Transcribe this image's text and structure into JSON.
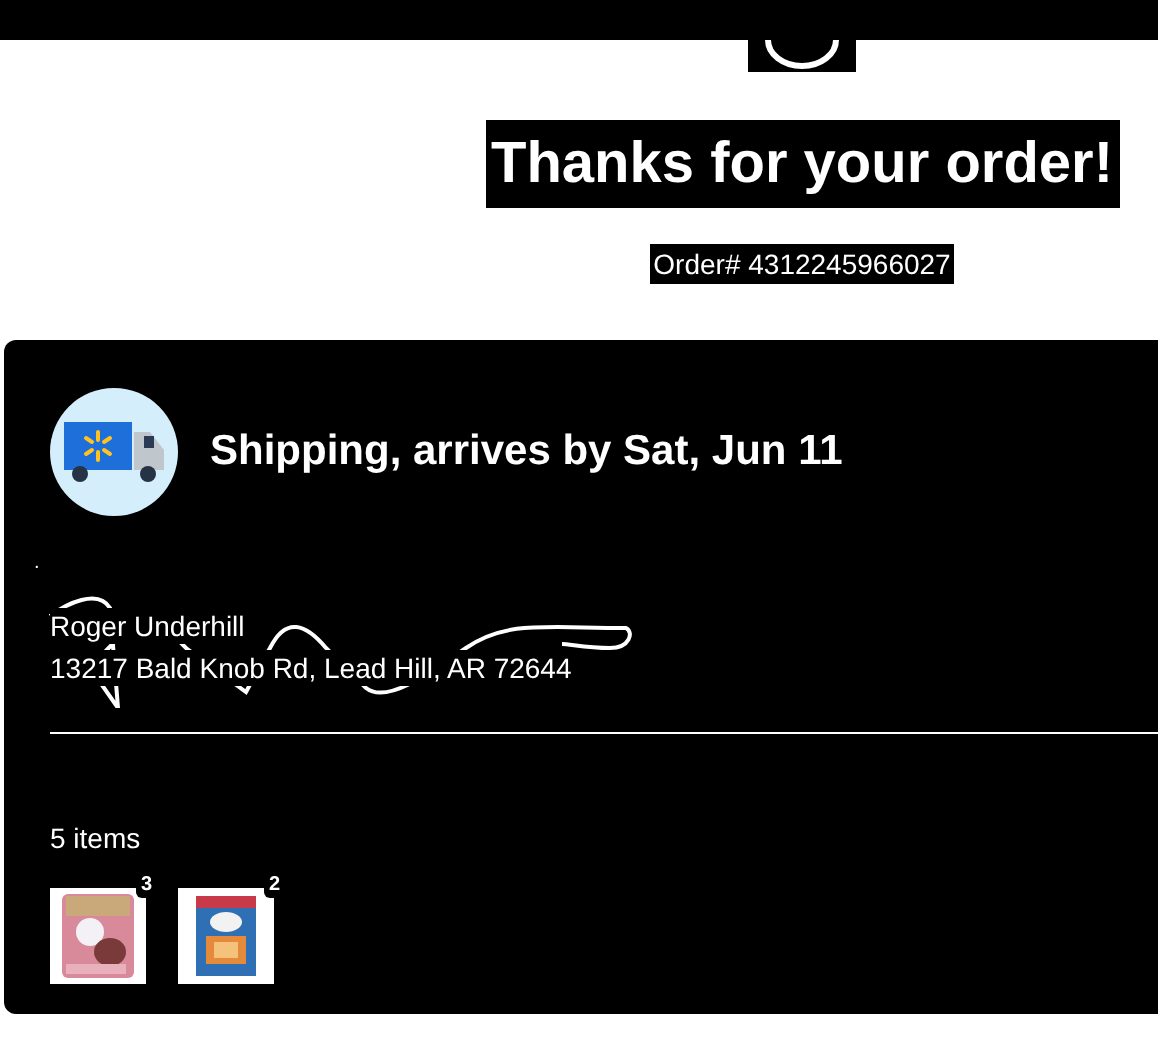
{
  "header": {
    "title": "Thanks for your order!",
    "order_number": "Order# 4312245966027"
  },
  "shipment": {
    "heading": "Shipping, arrives by Sat, Jun 11",
    "marker": ".",
    "recipient": "Roger Underhill",
    "address": "13217 Bald Knob Rd, Lead Hill, AR 72644",
    "item_count": "5 items",
    "items": [
      {
        "kind": "picture",
        "quantity": "3"
      },
      {
        "kind": "picture",
        "quantity": "2"
      }
    ]
  }
}
